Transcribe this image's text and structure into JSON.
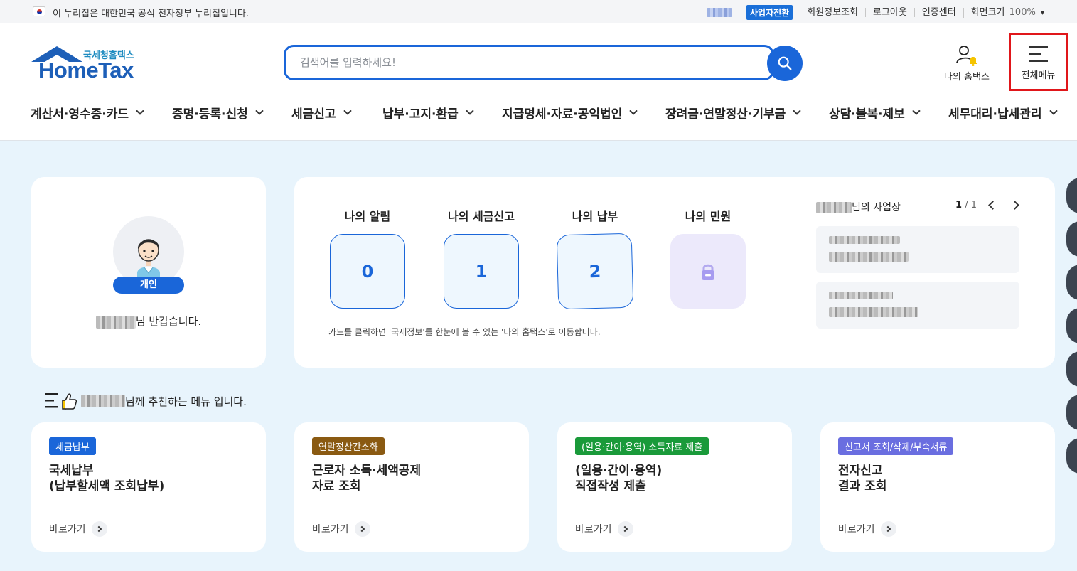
{
  "topbar": {
    "gov_notice": "이 누리집은 대한민국 공식 전자정부 누리집입니다.",
    "switch_business": "사업자전환",
    "links": [
      "회원정보조회",
      "로그아웃",
      "인증센터",
      "화면크기"
    ],
    "zoom": "100%"
  },
  "logo": {
    "kr": "국세청홈택스",
    "en": "HomeTax"
  },
  "search": {
    "placeholder": "검색어를 입력하세요!"
  },
  "header": {
    "my_hometax": "나의 홈택스",
    "all_menu": "전체메뉴"
  },
  "gnb": [
    "계산서·영수증·카드",
    "증명·등록·신청",
    "세금신고",
    "납부·고지·환급",
    "지급명세·자료·공익법인",
    "장려금·연말정산·기부금",
    "상담·불복·제보",
    "세무대리·납세관리"
  ],
  "profile": {
    "type_badge": "개인",
    "greeting_suffix": "님 반갑습니다."
  },
  "summary": {
    "stats": [
      {
        "label": "나의 알림",
        "value": "0"
      },
      {
        "label": "나의 세금신고",
        "value": "1"
      },
      {
        "label": "나의 납부",
        "value": "2"
      },
      {
        "label": "나의 민원",
        "value": ""
      }
    ],
    "hint": "카드를 클릭하면 '국세정보'를 한눈에 볼 수 있는 '나의 홈택스'로 이동합니다.",
    "business_title_suffix": "님의 사업장",
    "page_current": "1",
    "page_total": "/ 1"
  },
  "recommend": {
    "title_suffix": "님께 추천하는 메뉴 입니다.",
    "cards": [
      {
        "tag": "세금납부",
        "tag_color": "#1a66d9",
        "title": "국세납부\n(납부할세액 조회납부)",
        "link": "바로가기"
      },
      {
        "tag": "연말정산간소화",
        "tag_color": "#8a5a12",
        "title": "근로자 소득·세액공제\n자료 조회",
        "link": "바로가기"
      },
      {
        "tag": "(일용·간이·용역) 소득자료 제출",
        "tag_color": "#1a9a3a",
        "title": "(일용·간이·용역)\n직접작성 제출",
        "link": "바로가기"
      },
      {
        "tag": "신고서 조회/삭제/부속서류",
        "tag_color": "#6a6ee0",
        "title": "전자신고\n결과 조회",
        "link": "바로가기"
      }
    ]
  }
}
